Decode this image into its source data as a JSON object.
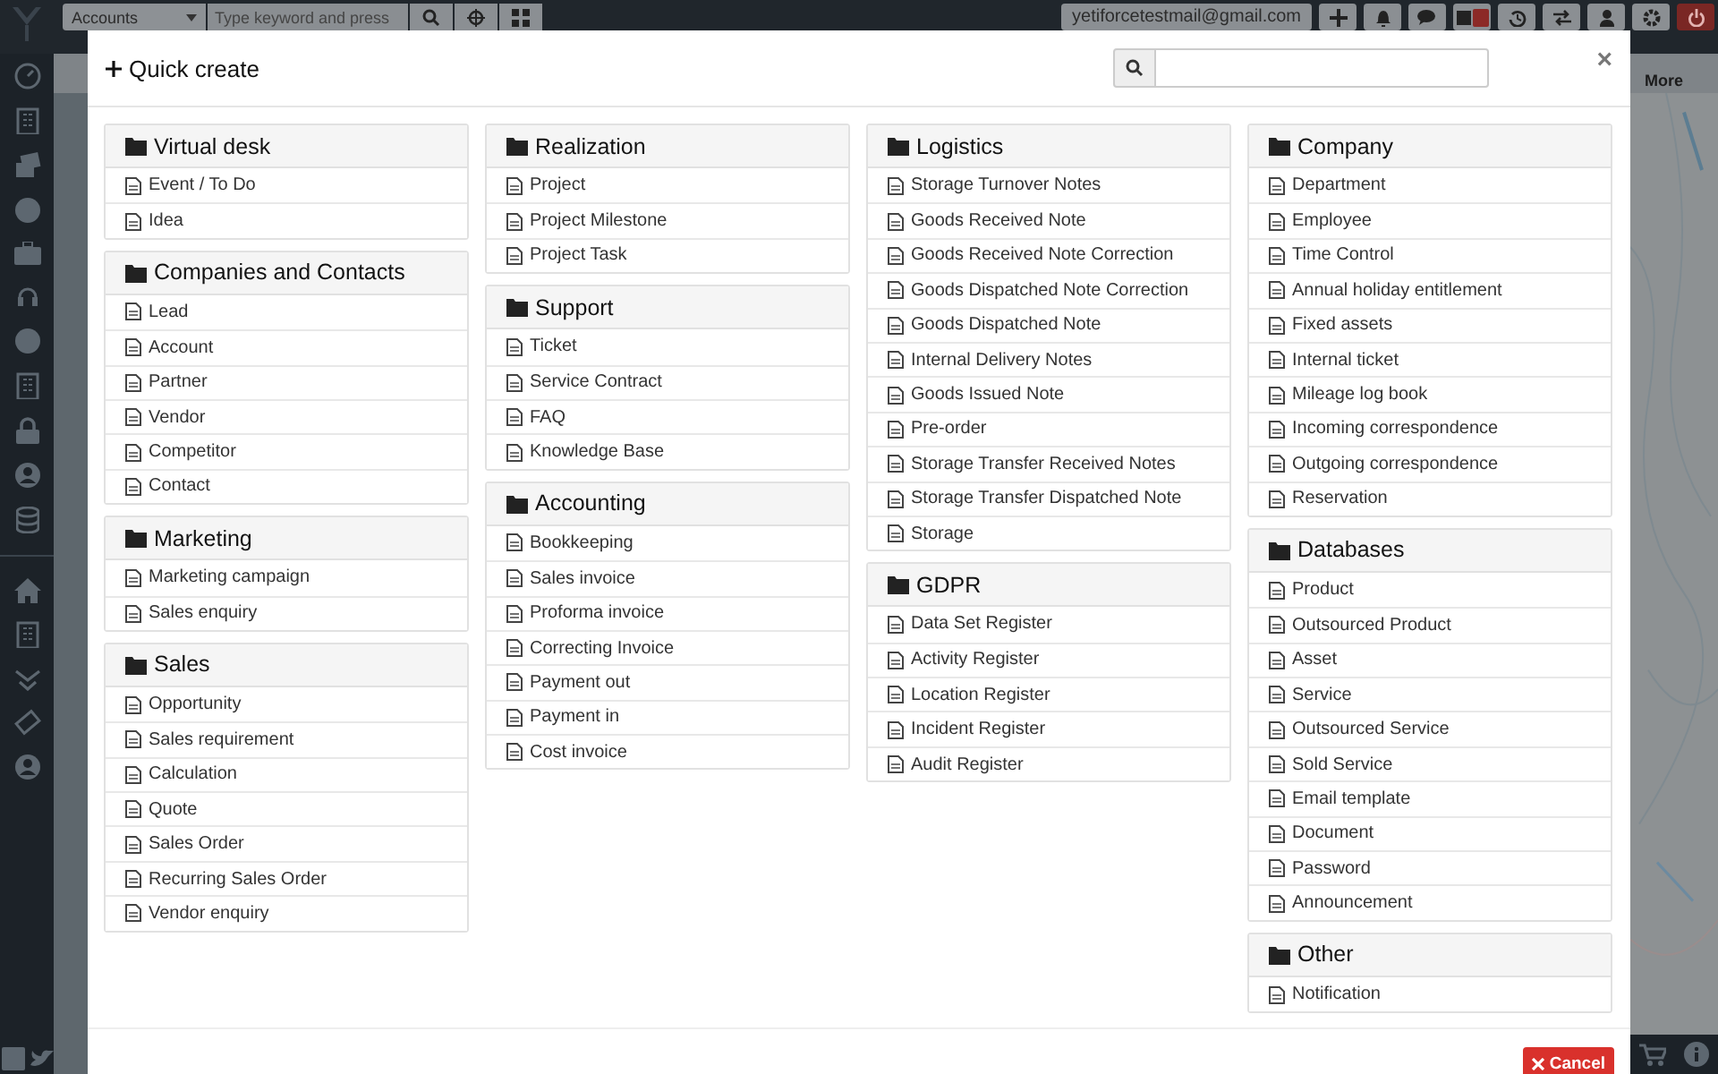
{
  "topbar": {
    "module_select": "Accounts",
    "search_placeholder": "Type keyword and press",
    "user_email": "yetiforcetestmail@gmail.com"
  },
  "page": {
    "more_tab": "More"
  },
  "modal": {
    "title": "Quick create",
    "close": "×",
    "cancel": "Cancel",
    "columns": [
      [
        {
          "title": "Virtual desk",
          "items": [
            "Event / To Do",
            "Idea"
          ]
        },
        {
          "title": "Companies and Contacts",
          "items": [
            "Lead",
            "Account",
            "Partner",
            "Vendor",
            "Competitor",
            "Contact"
          ]
        },
        {
          "title": "Marketing",
          "items": [
            "Marketing campaign",
            "Sales enquiry"
          ]
        },
        {
          "title": "Sales",
          "items": [
            "Opportunity",
            "Sales requirement",
            "Calculation",
            "Quote",
            "Sales Order",
            "Recurring Sales Order",
            "Vendor enquiry"
          ]
        }
      ],
      [
        {
          "title": "Realization",
          "items": [
            "Project",
            "Project Milestone",
            "Project Task"
          ]
        },
        {
          "title": "Support",
          "items": [
            "Ticket",
            "Service Contract",
            "FAQ",
            "Knowledge Base"
          ]
        },
        {
          "title": "Accounting",
          "items": [
            "Bookkeeping",
            "Sales invoice",
            "Proforma invoice",
            "Correcting Invoice",
            "Payment out",
            "Payment in",
            "Cost invoice"
          ]
        }
      ],
      [
        {
          "title": "Logistics",
          "items": [
            "Storage Turnover Notes",
            "Goods Received Note",
            "Goods Received Note Correction",
            "Goods Dispatched Note Correction",
            "Goods Dispatched Note",
            "Internal Delivery Notes",
            "Goods Issued Note",
            "Pre-order",
            "Storage Transfer Received Notes",
            "Storage Transfer Dispatched Note",
            "Storage"
          ]
        },
        {
          "title": "GDPR",
          "items": [
            "Data Set Register",
            "Activity Register",
            "Location Register",
            "Incident Register",
            "Audit Register"
          ]
        }
      ],
      [
        {
          "title": "Company",
          "items": [
            "Department",
            "Employee",
            "Time Control",
            "Annual holiday entitlement",
            "Fixed assets",
            "Internal ticket",
            "Mileage log book",
            "Incoming correspondence",
            "Outgoing correspondence",
            "Reservation"
          ]
        },
        {
          "title": "Databases",
          "items": [
            "Product",
            "Outsourced Product",
            "Asset",
            "Service",
            "Outsourced Service",
            "Sold Service",
            "Email template",
            "Document",
            "Password",
            "Announcement"
          ]
        },
        {
          "title": "Other",
          "items": [
            "Notification"
          ]
        }
      ]
    ]
  }
}
